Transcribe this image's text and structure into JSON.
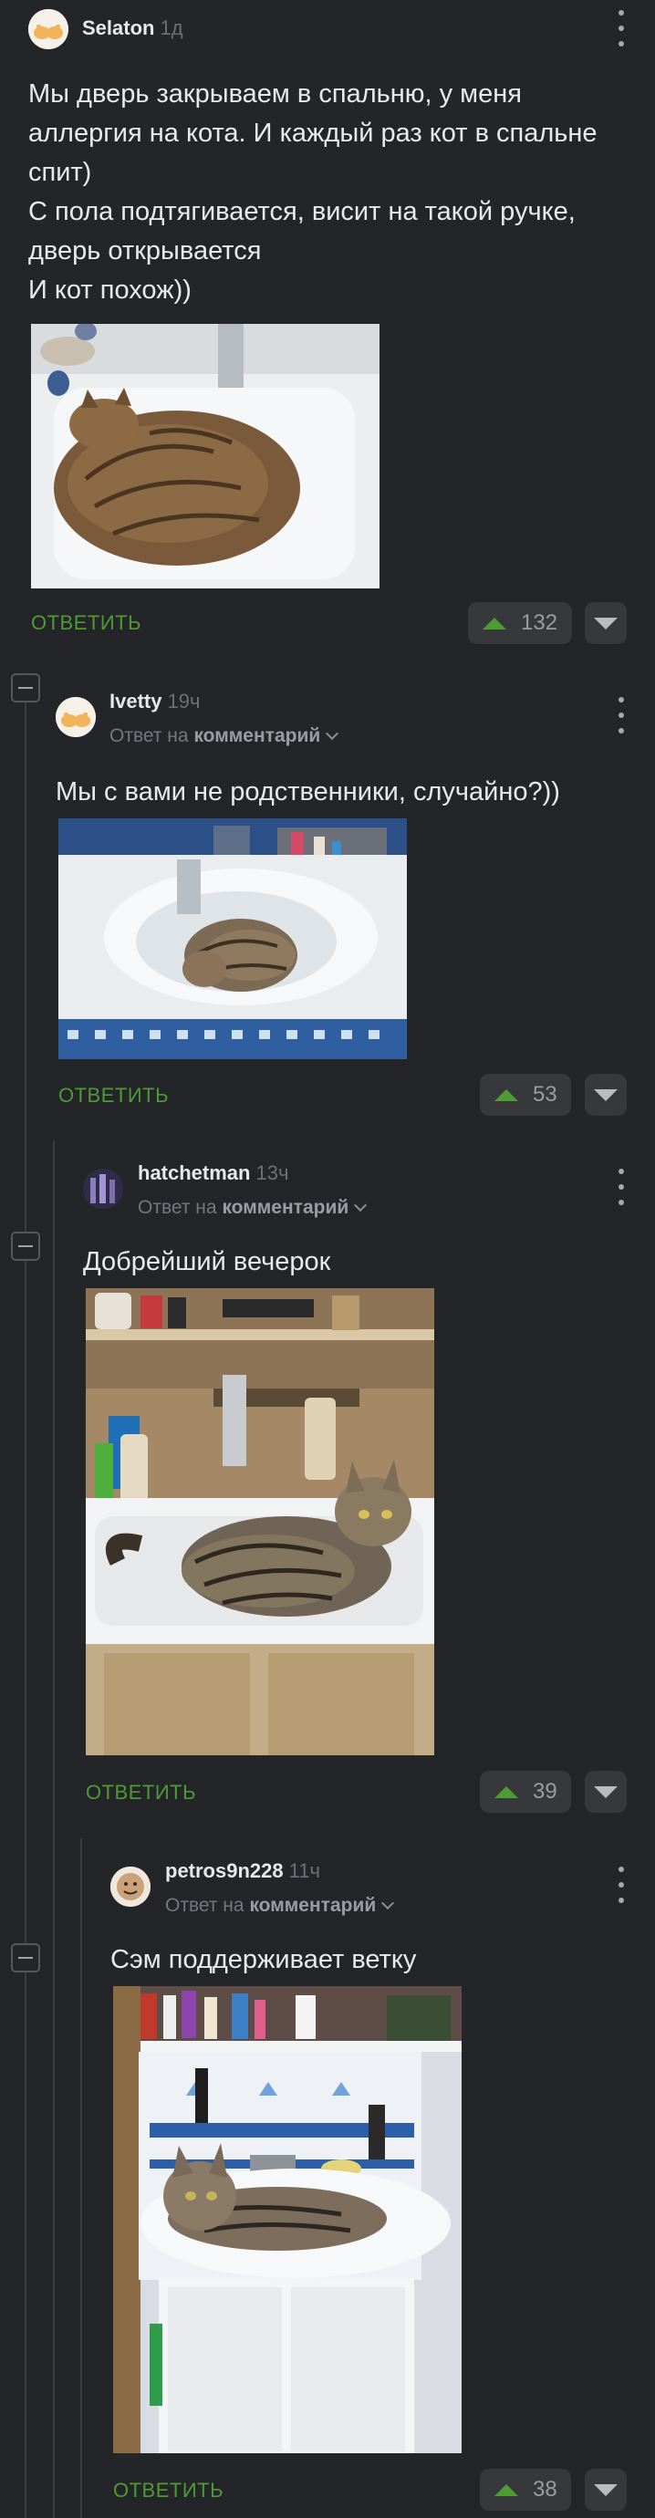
{
  "comments": [
    {
      "username": "Selaton",
      "time": "1д",
      "text": "Мы дверь закрываем в спальню, у меня аллергия на кота. И каждый раз кот в спальне спит)\nС пола подтягивается, висит на такой ручке, дверь открывается\nИ кот похож))",
      "reply_label": "ОТВЕТИТЬ",
      "votes": "132"
    },
    {
      "username": "Ivetty",
      "time": "19ч",
      "reply_to_prefix": "Ответ на",
      "reply_to_target": "комментарий",
      "text": "Мы с вами не родственники, случайно?))",
      "reply_label": "ОТВЕТИТЬ",
      "votes": "53"
    },
    {
      "username": "hatchetman",
      "time": "13ч",
      "reply_to_prefix": "Ответ на",
      "reply_to_target": "комментарий",
      "text": "Добрейший вечерок",
      "reply_label": "ОТВЕТИТЬ",
      "votes": "39"
    },
    {
      "username": "petros9n228",
      "time": "11ч",
      "reply_to_prefix": "Ответ на",
      "reply_to_target": "комментарий",
      "text": "Сэм поддерживает ветку",
      "reply_label": "ОТВЕТИТЬ",
      "votes": "38"
    }
  ],
  "icons": {
    "upvote": "triangle-up-icon",
    "downvote": "triangle-down-icon",
    "more": "vertical-dots-icon",
    "collapse": "minus-box-icon",
    "reply_dropdown": "chevron-down-icon"
  },
  "colors": {
    "background": "#242528",
    "accent_green": "#4e9a35",
    "vote_bg": "#36383c"
  }
}
